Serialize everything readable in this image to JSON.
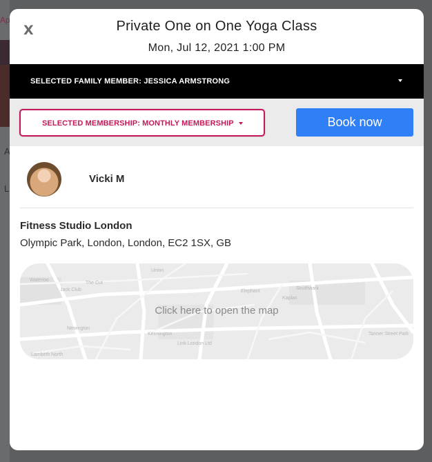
{
  "background": {
    "app_text": "Ap",
    "marks": [
      "A",
      "L"
    ]
  },
  "modal": {
    "close_label": "X",
    "title": "Private One on One Yoga Class",
    "datetime": "Mon, Jul 12, 2021 1:00 PM",
    "family_member_label": "SELECTED FAMILY MEMBER: JESSICA ARMSTRONG",
    "membership_label": "SELECTED MEMBERSHIP: MONTHLY MEMBERSHIP",
    "book_label": "Book now",
    "instructor": {
      "name": "Vicki M",
      "avatar_icon": "avatar-photo"
    },
    "venue": {
      "name": "Fitness Studio London",
      "address": "Olympic Park, London, London, EC2 1SX, GB"
    },
    "map": {
      "label": "Click here to open the map",
      "street_labels": [
        "Waterloo",
        "Jack Club",
        "The Cut",
        "Union",
        "Southwark",
        "Kennington",
        "Elephant",
        "Kaplan",
        "Newington",
        "Link London Ltd",
        "Tanner Street Park",
        "Lambeth North"
      ]
    }
  },
  "colors": {
    "accent_pink": "#c2185b",
    "primary_blue": "#2f7ff7",
    "family_bar": "#000000"
  }
}
